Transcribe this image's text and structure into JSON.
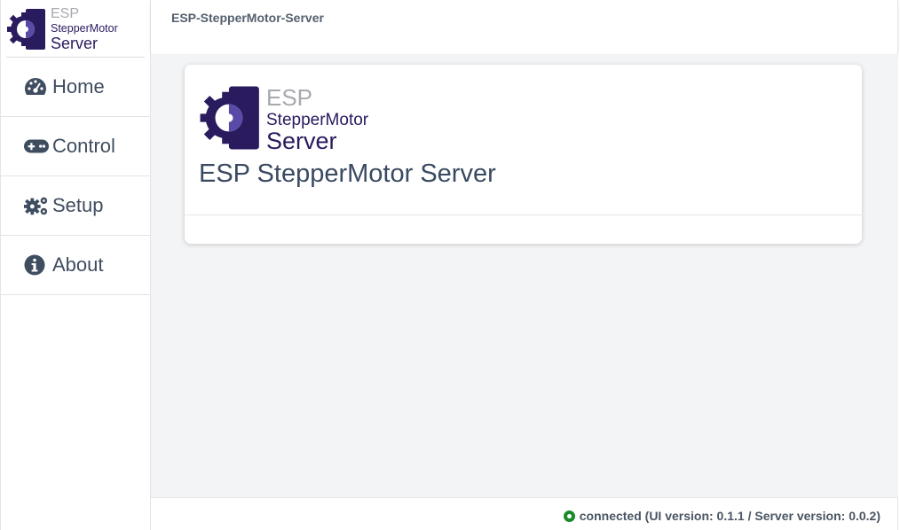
{
  "brand": {
    "line1": "ESP",
    "line2": "StepperMotor",
    "line3": "Server",
    "color_primary": "#2a1a5e",
    "color_muted": "#a8a8b0"
  },
  "sidebar": {
    "items": [
      {
        "label": "Home",
        "icon": "gauge-icon"
      },
      {
        "label": "Control",
        "icon": "gamepad-icon"
      },
      {
        "label": "Setup",
        "icon": "gears-icon"
      },
      {
        "label": "About",
        "icon": "info-circle-icon"
      }
    ]
  },
  "topbar": {
    "title": "ESP-StepperMotor-Server"
  },
  "main": {
    "card_title": "ESP StepperMotor Server"
  },
  "footer": {
    "status_text": "connected (UI version: 0.1.1 / Server version: 0.0.2)",
    "status_color": "#1a8a2a"
  }
}
